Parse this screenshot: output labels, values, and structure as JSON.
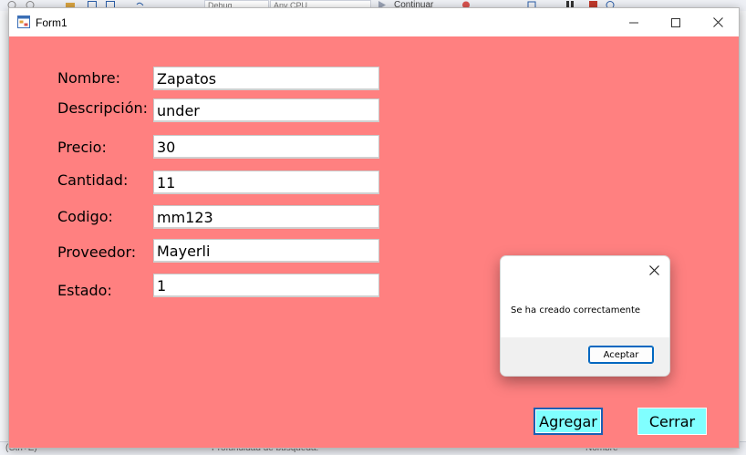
{
  "ide": {
    "config_combo": "Debug",
    "platform_combo": "Any CPU",
    "run_label": "Continuar",
    "search_shortcut": "(Ctrl+E)",
    "search_depth_label": "Profundidad de búsqueda:",
    "right_panel_text": "Nombre"
  },
  "window": {
    "title": "Form1",
    "back_color": "#ff8080"
  },
  "form": {
    "fields": [
      {
        "label": "Nombre:",
        "value": "Zapatos"
      },
      {
        "label": "Descripción:",
        "value": "under"
      },
      {
        "label": "Precio:",
        "value": "30"
      },
      {
        "label": "Cantidad:",
        "value": "11"
      },
      {
        "label": "Codigo:",
        "value": "mm123"
      },
      {
        "label": "Proveedor:",
        "value": "Mayerli"
      },
      {
        "label": "Estado:",
        "value": "1"
      }
    ],
    "add_button": "Agregar",
    "close_button": "Cerrar",
    "button_color": "#80ffff"
  },
  "dialog": {
    "message": "Se ha creado correctamente",
    "ok_button": "Aceptar"
  },
  "icons": [
    "app-icon",
    "minimize-icon",
    "maximize-icon",
    "close-icon",
    "dialog-close-icon"
  ]
}
